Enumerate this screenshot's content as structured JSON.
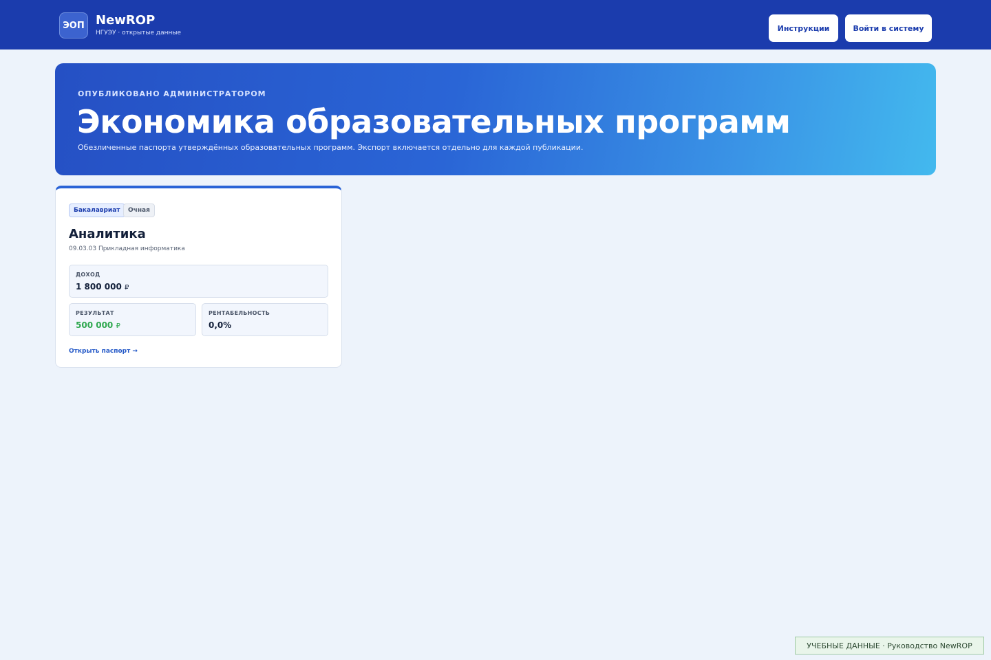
{
  "header": {
    "logo_text": "ЭОП",
    "brand_name": "NewROP",
    "brand_sub": "НГУЭУ · открытые данные",
    "instructions_label": "Инструкции",
    "login_label": "Войти в систему"
  },
  "hero": {
    "kicker": "ОПУБЛИКОВАНО АДМИНИСТРАТОРОМ",
    "title": "Экономика образовательных программ",
    "description": "Обезличенные паспорта утверждённых образовательных программ. Экспорт включается отдельно для каждой публикации."
  },
  "programs": [
    {
      "tags": [
        "Бакалавриат",
        "Очная"
      ],
      "title": "Аналитика",
      "code": "09.03.03 Прикладная информатика",
      "income": {
        "label": "ДОХОД",
        "value": "1 800 000",
        "currency": "₽"
      },
      "result": {
        "label": "РЕЗУЛЬТАТ",
        "value": "500 000",
        "currency": "₽"
      },
      "margin": {
        "label": "РЕНТАБЕЛЬНОСТЬ",
        "value": "0,0%"
      },
      "link_label": "Открыть паспорт →"
    }
  ],
  "footer": {
    "badge": "УЧЕБНЫЕ ДАННЫЕ · Руководство NewROP"
  },
  "colors": {
    "header_bg": "#1b3cad",
    "accent": "#2a63d6",
    "positive": "#2fa84f",
    "page_bg": "#edf3fb"
  }
}
